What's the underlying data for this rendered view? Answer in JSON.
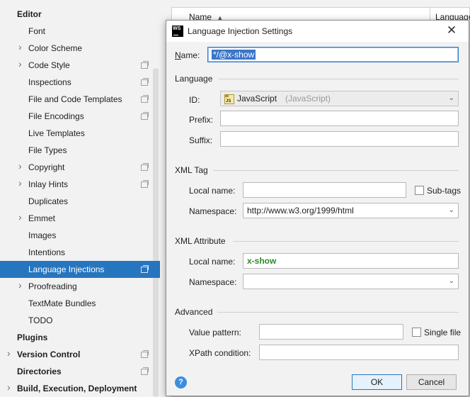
{
  "settings_tree": {
    "items": [
      {
        "label": "Editor",
        "header": true,
        "arrow": false,
        "project_icon": false,
        "selected": false
      },
      {
        "label": "Font",
        "header": false,
        "arrow": false,
        "project_icon": false,
        "selected": false
      },
      {
        "label": "Color Scheme",
        "header": false,
        "arrow": true,
        "project_icon": false,
        "selected": false
      },
      {
        "label": "Code Style",
        "header": false,
        "arrow": true,
        "project_icon": true,
        "selected": false
      },
      {
        "label": "Inspections",
        "header": false,
        "arrow": false,
        "project_icon": true,
        "selected": false
      },
      {
        "label": "File and Code Templates",
        "header": false,
        "arrow": false,
        "project_icon": true,
        "selected": false
      },
      {
        "label": "File Encodings",
        "header": false,
        "arrow": false,
        "project_icon": true,
        "selected": false
      },
      {
        "label": "Live Templates",
        "header": false,
        "arrow": false,
        "project_icon": false,
        "selected": false
      },
      {
        "label": "File Types",
        "header": false,
        "arrow": false,
        "project_icon": false,
        "selected": false
      },
      {
        "label": "Copyright",
        "header": false,
        "arrow": true,
        "project_icon": true,
        "selected": false
      },
      {
        "label": "Inlay Hints",
        "header": false,
        "arrow": true,
        "project_icon": true,
        "selected": false
      },
      {
        "label": "Duplicates",
        "header": false,
        "arrow": false,
        "project_icon": false,
        "selected": false
      },
      {
        "label": "Emmet",
        "header": false,
        "arrow": true,
        "project_icon": false,
        "selected": false
      },
      {
        "label": "Images",
        "header": false,
        "arrow": false,
        "project_icon": false,
        "selected": false
      },
      {
        "label": "Intentions",
        "header": false,
        "arrow": false,
        "project_icon": false,
        "selected": false
      },
      {
        "label": "Language Injections",
        "header": false,
        "arrow": false,
        "project_icon": true,
        "selected": true
      },
      {
        "label": "Proofreading",
        "header": false,
        "arrow": true,
        "project_icon": false,
        "selected": false
      },
      {
        "label": "TextMate Bundles",
        "header": false,
        "arrow": false,
        "project_icon": false,
        "selected": false
      },
      {
        "label": "TODO",
        "header": false,
        "arrow": false,
        "project_icon": false,
        "selected": false
      },
      {
        "label": "Plugins",
        "header": true,
        "arrow": false,
        "project_icon": false,
        "selected": false
      },
      {
        "label": "Version Control",
        "header": true,
        "arrow": true,
        "project_icon": true,
        "selected": false
      },
      {
        "label": "Directories",
        "header": true,
        "arrow": false,
        "project_icon": true,
        "selected": false
      },
      {
        "label": "Build, Execution, Deployment",
        "header": true,
        "arrow": true,
        "project_icon": false,
        "selected": false
      }
    ]
  },
  "background_table": {
    "col_name": "Name",
    "col_language": "Language"
  },
  "dialog": {
    "title": "Language Injection Settings",
    "logo_text": "WS",
    "name_label": "Name:",
    "name_value": "*/@x-show",
    "language_section": "Language",
    "id_label": "ID:",
    "id_value": "JavaScript",
    "id_hint": "(JavaScript)",
    "js_icon_text": "JS",
    "prefix_label": "Prefix:",
    "prefix_value": "",
    "suffix_label": "Suffix:",
    "suffix_value": "",
    "xml_tag_section": "XML Tag",
    "tag_local_name_label": "Local name:",
    "tag_local_name_value": "",
    "subtags_label": "Sub-tags",
    "subtags_checked": false,
    "tag_namespace_label": "Namespace:",
    "tag_namespace_value": "http://www.w3.org/1999/html",
    "xml_attr_section": "XML Attribute",
    "attr_local_name_label": "Local name:",
    "attr_local_name_value": "x-show",
    "attr_namespace_label": "Namespace:",
    "attr_namespace_value": "",
    "advanced_section": "Advanced",
    "value_pattern_label": "Value pattern:",
    "value_pattern_value": "",
    "single_file_label": "Single file",
    "single_file_checked": false,
    "xpath_label": "XPath condition:",
    "xpath_value": "",
    "ok_label": "OK",
    "cancel_label": "Cancel",
    "help_label": "?"
  }
}
